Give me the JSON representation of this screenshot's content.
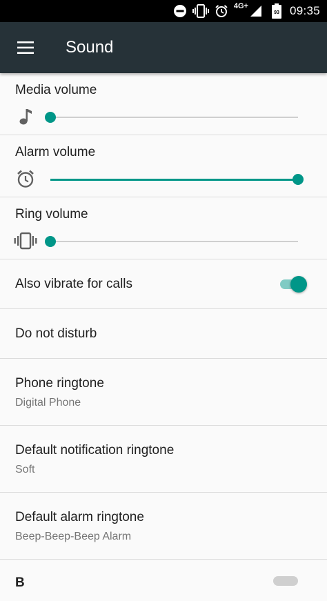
{
  "status_bar": {
    "network": "4G+",
    "battery": "93",
    "time": "09:35",
    "icons": [
      "do-not-disturb-icon",
      "vibrate-icon",
      "alarm-icon",
      "signal-icon",
      "battery-icon"
    ]
  },
  "app_bar": {
    "title": "Sound",
    "menu_icon": "hamburger-menu-icon"
  },
  "accent_color": "#009688",
  "volume": {
    "media": {
      "label": "Media volume",
      "level": 0,
      "icon": "music-note-icon"
    },
    "alarm": {
      "label": "Alarm volume",
      "level": 1.0,
      "icon": "alarm-clock-icon"
    },
    "ring": {
      "label": "Ring volume",
      "level": 0,
      "icon": "vibrate-icon"
    }
  },
  "vibrate_calls": {
    "label": "Also vibrate for calls",
    "enabled": true
  },
  "do_not_disturb": {
    "label": "Do not disturb"
  },
  "phone_ringtone": {
    "title": "Phone ringtone",
    "value": "Digital Phone"
  },
  "notification_ringtone": {
    "title": "Default notification ringtone",
    "value": "Soft"
  },
  "alarm_ringtone": {
    "title": "Default alarm ringtone",
    "value": "Beep-Beep-Beep Alarm"
  },
  "partial_item": {
    "title": "B",
    "enabled": false
  }
}
